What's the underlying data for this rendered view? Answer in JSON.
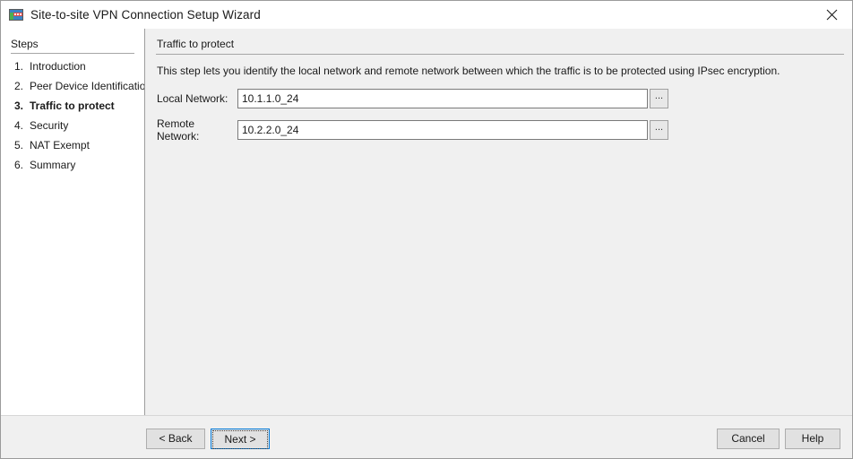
{
  "window": {
    "title": "Site-to-site VPN Connection Setup Wizard",
    "icon": "vpn-wizard-icon",
    "close_label": "close-icon"
  },
  "sidebar": {
    "header": "Steps",
    "items": [
      {
        "number": "1.",
        "label": "Introduction",
        "current": false
      },
      {
        "number": "2.",
        "label": "Peer Device Identificatio",
        "current": false
      },
      {
        "number": "3.",
        "label": "Traffic to protect",
        "current": true
      },
      {
        "number": "4.",
        "label": "Security",
        "current": false
      },
      {
        "number": "5.",
        "label": "NAT Exempt",
        "current": false
      },
      {
        "number": "6.",
        "label": "Summary",
        "current": false
      }
    ]
  },
  "main": {
    "section_title": "Traffic to protect",
    "description": "This step lets you identify the local network and remote network between which the traffic is to be protected using IPsec encryption.",
    "fields": [
      {
        "label": "Local Network:",
        "value": "10.1.1.0_24",
        "placeholder": "",
        "browse_label": "..."
      },
      {
        "label": "Remote Network:",
        "value": "10.2.2.0_24",
        "placeholder": "",
        "browse_label": "..."
      }
    ]
  },
  "footer": {
    "back_label": "< Back",
    "next_label": "Next >",
    "cancel_label": "Cancel",
    "help_label": "Help"
  },
  "colors": {
    "dialog_background": "#f0f0f0",
    "panel_background": "#ffffff",
    "focus_outline": "#0078d7",
    "border": "#9d9d9d"
  }
}
